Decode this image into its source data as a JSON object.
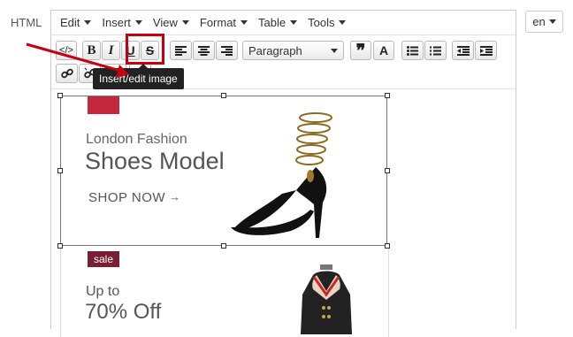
{
  "mode_label": "HTML",
  "menu": [
    "Edit",
    "Insert",
    "View",
    "Format",
    "Table",
    "Tools"
  ],
  "toolbar": {
    "source_code": "</>",
    "bold": "B",
    "italic": "I",
    "underline": "U",
    "strikethrough": "S",
    "format_value": "Paragraph",
    "text_color": "A"
  },
  "tooltip": "Insert/edit image",
  "banner1": {
    "subtitle": "London Fashion",
    "title": "Shoes Model",
    "cta": "SHOP NOW",
    "cta_arrow": "→"
  },
  "banner2": {
    "badge": "sale",
    "line1": "Up to",
    "line2": "70% Off"
  },
  "language": "en",
  "colors": {
    "highlight": "#c3000f",
    "sale_badge": "#7a1f33",
    "sale_red": "#c4283c"
  }
}
